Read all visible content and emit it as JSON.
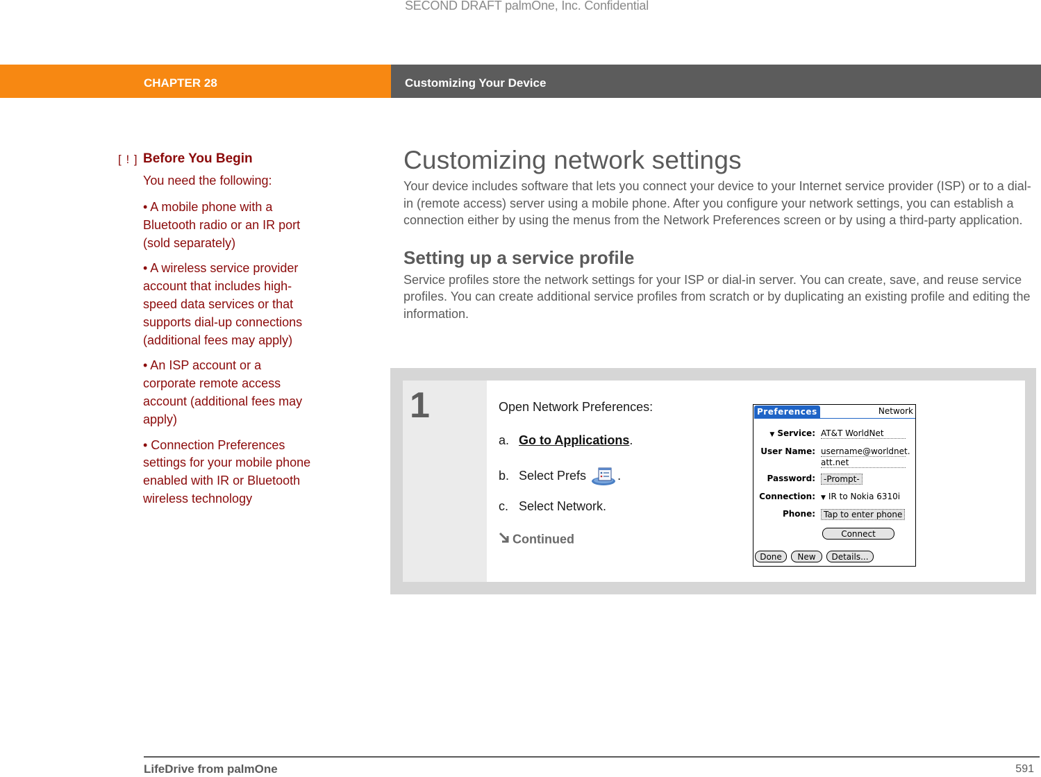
{
  "watermark": "SECOND DRAFT palmOne, Inc.  Confidential",
  "header": {
    "chapter": "CHAPTER 28",
    "title": "Customizing Your Device",
    "colors": {
      "chapter_bg": "#f78812",
      "title_bg": "#5c5c5c"
    }
  },
  "sidebar": {
    "marker": "[ ! ]",
    "title": "Before You Begin",
    "intro": "You need the following:",
    "items": [
      "•  A mobile phone with a Bluetooth radio or an IR port (sold separately)",
      "•  A wireless service provider account that includes high-speed data services or that supports dial-up connections (additional fees may apply)",
      "•  An ISP account or a corporate remote access account (additional fees may apply)",
      "•  Connection Preferences settings for your mobile phone enabled with IR or Bluetooth wireless technology"
    ],
    "color": "#8b0a0a"
  },
  "main": {
    "title": "Customizing network settings",
    "intro": "Your device includes software that lets you connect your device to your Internet service provider (ISP) or to a dial-in (remote access) server using a mobile phone. After you configure your network settings, you can establish a connection either by using the menus from the Network Preferences screen or by using a third-party application.",
    "section_title": "Setting up a service profile",
    "section_body": "Service profiles store the network settings for your ISP or dial-in server. You can create, save, and reuse service profiles. You can create additional service profiles from scratch or by duplicating an existing profile and editing the information."
  },
  "step": {
    "number": "1",
    "heading": "Open Network Preferences:",
    "a_label": "a.",
    "a_link": "Go to Applications",
    "a_suffix": ".",
    "b_label": "b.",
    "b_text": "Select Prefs",
    "b_icon": "prefs-app-icon",
    "b_suffix": ".",
    "c_label": "c.",
    "c_text": "Select Network.",
    "continued": "Continued"
  },
  "device_screen": {
    "tab": "Preferences",
    "panel": "Network",
    "service_label": "Service:",
    "service_value": "AT&T WorldNet",
    "username_label": "User Name:",
    "username_value_1": "username@worldnet.",
    "username_value_2": "att.net",
    "password_label": "Password:",
    "password_value": "-Prompt-",
    "connection_label": "Connection:",
    "connection_value": "IR to Nokia 6310i",
    "phone_label": "Phone:",
    "phone_value": "Tap to enter phone",
    "connect_button": "Connect",
    "done_button": "Done",
    "new_button": "New",
    "details_button": "Details..."
  },
  "footer": {
    "book": "LifeDrive from palmOne",
    "page": "591"
  }
}
